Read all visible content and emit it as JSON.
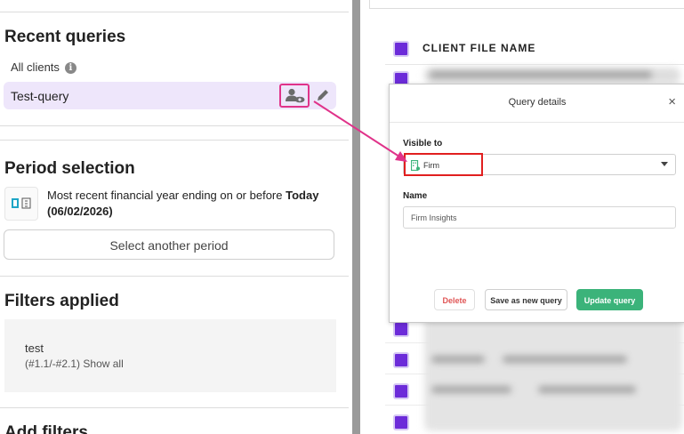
{
  "left_panel": {
    "recent_queries": {
      "title": "Recent queries",
      "all_clients": "All clients",
      "items": [
        {
          "name": "Test-query"
        }
      ]
    },
    "period": {
      "title": "Period selection",
      "description": "Most recent financial year ending on or before ",
      "bold_date": "Today (06/02/2026)",
      "button_label": "Select another period"
    },
    "filters": {
      "title": "Filters applied",
      "items": [
        {
          "name": "test",
          "detail": "(#1.1/-#2.1)",
          "show_all": "Show all"
        }
      ]
    },
    "add_filters": {
      "title": "Add filters"
    }
  },
  "table": {
    "header": "CLIENT FILE NAME"
  },
  "modal": {
    "title": "Query details",
    "close": "×",
    "visible_to_label": "Visible to",
    "visible_to_value": "Firm",
    "name_label": "Name",
    "name_value": "Firm Insights",
    "buttons": {
      "delete": "Delete",
      "save_new": "Save as new query",
      "update": "Update query"
    }
  },
  "colors": {
    "accent": "#6c2bd9",
    "highlight": "#e0338a",
    "red_outline": "#e11f1f",
    "update_button": "#3bb37a",
    "query_row_bg": "#eee6fb"
  }
}
